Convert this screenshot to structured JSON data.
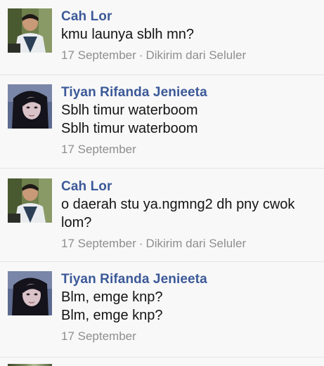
{
  "messages": [
    {
      "sender": "Cah Lor",
      "avatar": "boy-avatar",
      "lines": [
        "kmu launya sblh mn?"
      ],
      "date": "17 September",
      "via": "Dikirim dari Seluler"
    },
    {
      "sender": "Tiyan Rifanda Jenieeta",
      "avatar": "girl-avatar",
      "lines": [
        "Sblh timur waterboom",
        "Sblh timur waterboom"
      ],
      "date": "17 September",
      "via": ""
    },
    {
      "sender": "Cah Lor",
      "avatar": "boy-avatar",
      "lines": [
        "o daerah stu ya.ngmng2 dh pny cwok",
        "lom?"
      ],
      "date": "17 September",
      "via": "Dikirim dari Seluler"
    },
    {
      "sender": "Tiyan Rifanda Jenieeta",
      "avatar": "girl-avatar",
      "lines": [
        "Blm, emge knp?",
        "Blm, emge knp?"
      ],
      "date": "17 September",
      "via": ""
    }
  ],
  "meta_separator": "·"
}
